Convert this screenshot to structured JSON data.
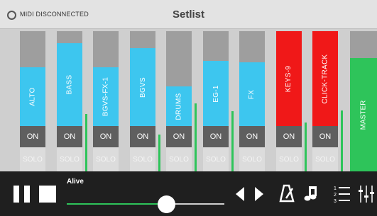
{
  "header": {
    "midi_status": "MIDI DISCONNECTED",
    "title": "Setlist"
  },
  "channels": [
    {
      "name": "ALTO",
      "on_label": "ON",
      "solo_label": "SOLO",
      "fader_level": 0.62,
      "meter_level": 0.0,
      "color": "#3dc6ef"
    },
    {
      "name": "BASS",
      "on_label": "ON",
      "solo_label": "SOLO",
      "fader_level": 0.87,
      "meter_level": 0.62,
      "color": "#3dc6ef"
    },
    {
      "name": "BGVS-FX-1",
      "on_label": "ON",
      "solo_label": "SOLO",
      "fader_level": 0.62,
      "meter_level": 0.0,
      "color": "#3dc6ef"
    },
    {
      "name": "BGVS",
      "on_label": "ON",
      "solo_label": "SOLO",
      "fader_level": 0.82,
      "meter_level": 0.4,
      "color": "#3dc6ef"
    },
    {
      "name": "DRUMS",
      "on_label": "ON",
      "solo_label": "SOLO",
      "fader_level": 0.42,
      "meter_level": 0.74,
      "color": "#3dc6ef"
    },
    {
      "name": "EG-1",
      "on_label": "ON",
      "solo_label": "SOLO",
      "fader_level": 0.69,
      "meter_level": 0.65,
      "color": "#3dc6ef"
    },
    {
      "name": "FX",
      "on_label": "ON",
      "solo_label": "SOLO",
      "fader_level": 0.67,
      "meter_level": 0.0,
      "color": "#3dc6ef"
    },
    {
      "name": "KEYS-9",
      "on_label": "ON",
      "solo_label": "SOLO",
      "fader_level": 1.0,
      "meter_level": 0.53,
      "color": "#f01818"
    },
    {
      "name": "CLICK-TRACK",
      "on_label": "ON",
      "solo_label": "SOLO",
      "fader_level": 1.0,
      "meter_level": 0.66,
      "color": "#f01818"
    }
  ],
  "master": {
    "name": "MASTER",
    "color": "#2ec45a"
  },
  "transport": {
    "song_title": "Alive",
    "progress": 0.63,
    "icons": [
      "pause-icon",
      "stop-icon",
      "previous-icon",
      "next-icon",
      "metronome-icon",
      "music-note-icon",
      "setlist-icon",
      "mixer-icon"
    ]
  }
}
